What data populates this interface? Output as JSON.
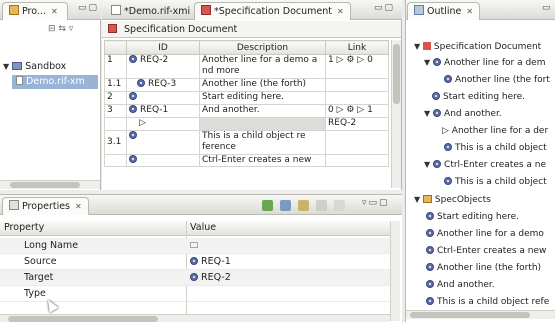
{
  "package_explorer": {
    "tab_title": "Pro...",
    "tree": [
      {
        "label": "Sandbox"
      },
      {
        "label": "Demo.rif-xm"
      }
    ]
  },
  "editor": {
    "tabs": [
      {
        "label": "*Demo.rif-xmi"
      },
      {
        "label": "*Specification Document"
      }
    ],
    "header": "Specification Document",
    "columns": [
      "ID",
      "Description",
      "Link"
    ],
    "rows": [
      {
        "num": "1",
        "id": "REQ-2",
        "desc": "Another line for a demo a nd more",
        "link": "1 ▷ ⚙ ▷ 0"
      },
      {
        "num": "1.1",
        "id": "REQ-3",
        "desc": "Another line (the forth)",
        "link": ""
      },
      {
        "num": "2",
        "id": "",
        "desc": "Start editing here.",
        "link": ""
      },
      {
        "num": "3",
        "id": "REQ-1",
        "desc": "And another.",
        "link": "0 ▷ ⚙ ▷ 1"
      },
      {
        "num": "",
        "id": "▷",
        "desc": "",
        "link": "REQ-2"
      },
      {
        "num": "3.1",
        "id": "",
        "desc": "This is a child object re ference",
        "link": ""
      },
      {
        "num": "4",
        "id": "",
        "desc": "Ctrl-Enter creates a new",
        "link": ""
      }
    ]
  },
  "properties": {
    "tab_title": "Properties",
    "columns": [
      "Property",
      "Value"
    ],
    "rows": [
      {
        "key": "Long Name",
        "value": ""
      },
      {
        "key": "Source",
        "value": "REQ-1"
      },
      {
        "key": "Target",
        "value": "REQ-2"
      },
      {
        "key": "Type",
        "value": ""
      }
    ]
  },
  "outline": {
    "tab_title": "Outline",
    "items": [
      {
        "label": "Specification Document"
      },
      {
        "label": "Another line for a dem"
      },
      {
        "label": "Another line (the fort"
      },
      {
        "label": "Start editing here."
      },
      {
        "label": "And another."
      },
      {
        "label": "Another line for a der"
      },
      {
        "label": "This is a child object"
      },
      {
        "label": "Ctrl-Enter creates a ne"
      },
      {
        "label": "This is a child object"
      },
      {
        "label": "SpecObjects"
      },
      {
        "label": "Start editing here."
      },
      {
        "label": "Another line for a demo"
      },
      {
        "label": "Ctrl-Enter creates a new"
      },
      {
        "label": "Another line (the forth)"
      },
      {
        "label": "And another."
      },
      {
        "label": "This is a child object refe"
      }
    ]
  }
}
